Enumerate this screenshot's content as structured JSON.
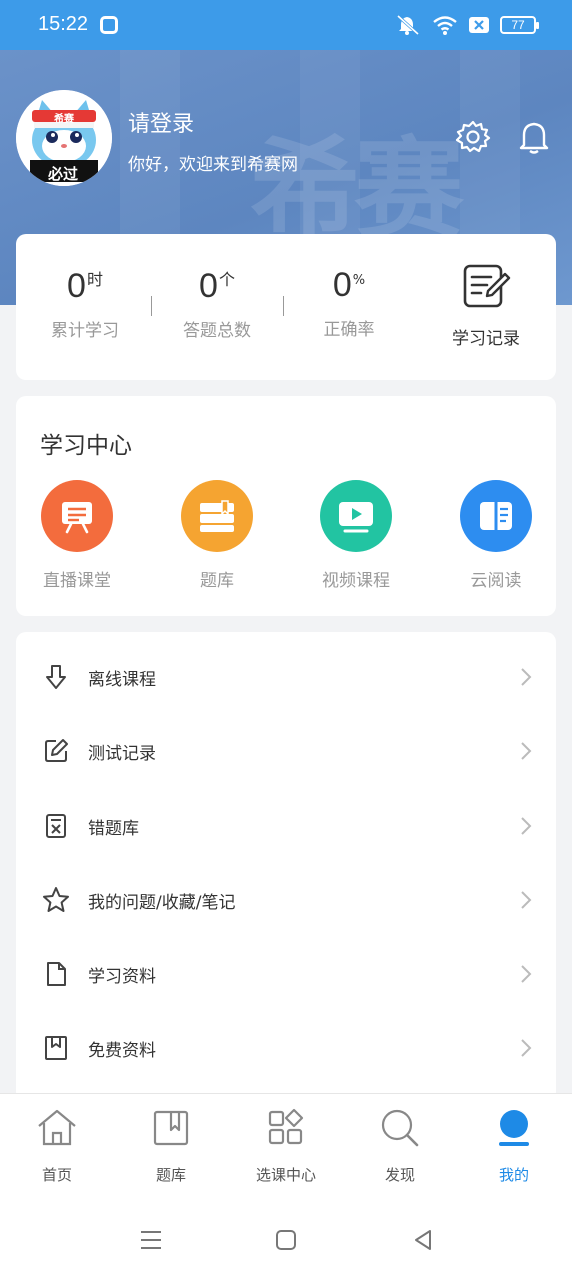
{
  "status_bar": {
    "time": "15:22",
    "battery": "77",
    "icons": [
      "app-icon",
      "mute-icon",
      "wifi-icon",
      "sim-x-icon"
    ]
  },
  "profile": {
    "avatar_badge_top": "希赛",
    "avatar_badge_bottom": "必过",
    "login_prompt": "请登录",
    "greeting": "你好，欢迎来到希赛网",
    "watermark": "希赛",
    "settings_icon": "gear-icon",
    "notification_icon": "bell-icon"
  },
  "stats": {
    "items": [
      {
        "value": "0",
        "unit": "时",
        "label": "累计学习"
      },
      {
        "value": "0",
        "unit": "个",
        "label": "答题总数"
      },
      {
        "value": "0",
        "unit": "%",
        "label": "正确率"
      }
    ],
    "record_label": "学习记录",
    "record_icon": "note-edit-icon"
  },
  "learning_center": {
    "title": "学习中心",
    "items": [
      {
        "label": "直播课堂",
        "icon": "live-board-icon",
        "color": "#f36c3d"
      },
      {
        "label": "题库",
        "icon": "book-stack-icon",
        "color": "#f5a431"
      },
      {
        "label": "视频课程",
        "icon": "video-play-icon",
        "color": "#22c4a2"
      },
      {
        "label": "云阅读",
        "icon": "open-book-icon",
        "color": "#2d8df0"
      }
    ]
  },
  "menu": {
    "items": [
      {
        "label": "离线课程",
        "icon": "download-arrow-icon"
      },
      {
        "label": "测试记录",
        "icon": "edit-note-icon"
      },
      {
        "label": "错题库",
        "icon": "wrong-questions-icon"
      },
      {
        "label": "我的问题/收藏/笔记",
        "icon": "star-icon"
      },
      {
        "label": "学习资料",
        "icon": "document-icon"
      },
      {
        "label": "免费资料",
        "icon": "bookmark-box-icon"
      }
    ]
  },
  "tabbar": {
    "items": [
      {
        "label": "首页",
        "icon": "home-icon",
        "active": false
      },
      {
        "label": "题库",
        "icon": "question-bank-icon",
        "active": false
      },
      {
        "label": "选课中心",
        "icon": "course-grid-icon",
        "active": false
      },
      {
        "label": "发现",
        "icon": "discover-search-icon",
        "active": false
      },
      {
        "label": "我的",
        "icon": "profile-icon",
        "active": true
      }
    ],
    "active_color": "#1e8ae6"
  },
  "colors": {
    "status_bar": "#3d9be9",
    "hero": "#5d86c0",
    "page_bg": "#f2f3f5"
  }
}
